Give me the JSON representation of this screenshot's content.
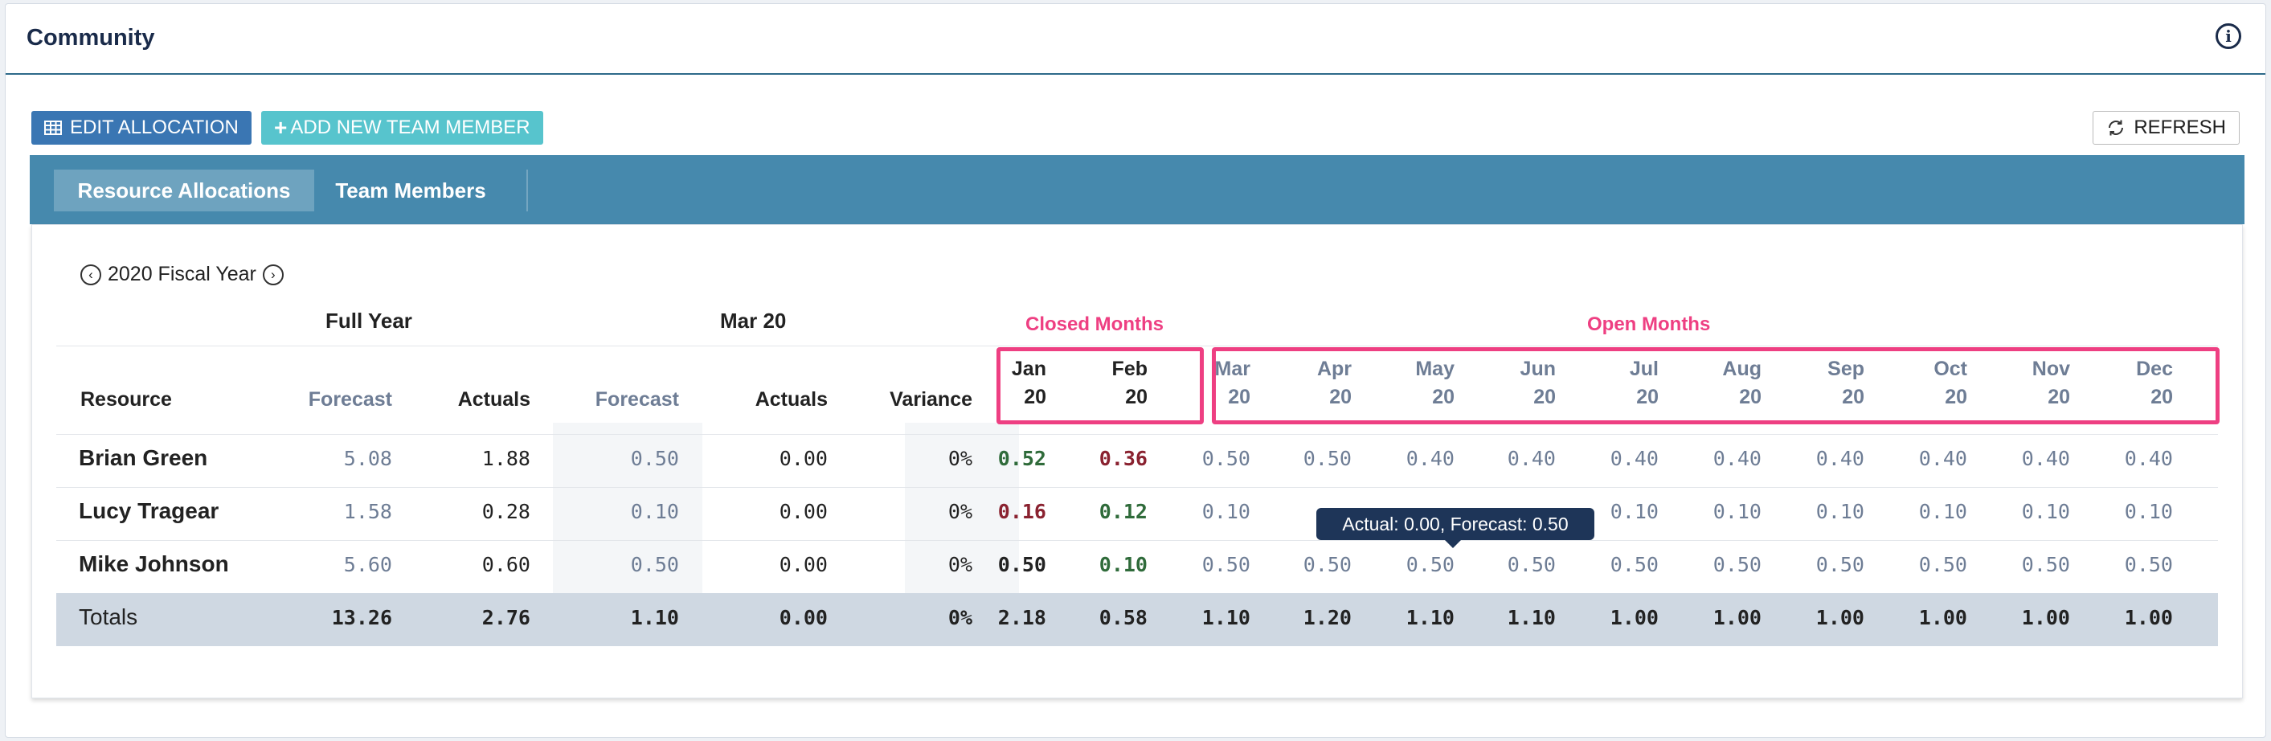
{
  "header": {
    "title": "Community",
    "info_icon": "info-icon"
  },
  "toolbar": {
    "edit_label": "EDIT ALLOCATION",
    "add_label": "ADD NEW TEAM MEMBER",
    "refresh_label": "REFRESH"
  },
  "tabs": [
    {
      "label": "Resource Allocations"
    },
    {
      "label": "Team Members"
    }
  ],
  "fiscal": {
    "label": "2020 Fiscal Year"
  },
  "groups": {
    "full_year": "Full Year",
    "current_month": "Mar 20",
    "closed": "Closed Months",
    "open": "Open Months"
  },
  "columns": {
    "resource": "Resource",
    "fy_forecast": "Forecast",
    "fy_actuals": "Actuals",
    "m_forecast": "Forecast",
    "m_actuals": "Actuals",
    "variance": "Variance"
  },
  "months": [
    {
      "m": "Jan",
      "y": "20"
    },
    {
      "m": "Feb",
      "y": "20"
    },
    {
      "m": "Mar",
      "y": "20"
    },
    {
      "m": "Apr",
      "y": "20"
    },
    {
      "m": "May",
      "y": "20"
    },
    {
      "m": "Jun",
      "y": "20"
    },
    {
      "m": "Jul",
      "y": "20"
    },
    {
      "m": "Aug",
      "y": "20"
    },
    {
      "m": "Sep",
      "y": "20"
    },
    {
      "m": "Oct",
      "y": "20"
    },
    {
      "m": "Nov",
      "y": "20"
    },
    {
      "m": "Dec",
      "y": "20"
    }
  ],
  "rows": [
    {
      "name": "Brian Green",
      "fy_forecast": "5.08",
      "fy_actuals": "1.88",
      "m_forecast": "0.50",
      "m_actuals": "0.00",
      "variance": "0%",
      "months": [
        "0.52",
        "0.36",
        "0.50",
        "0.50",
        "0.40",
        "0.40",
        "0.40",
        "0.40",
        "0.40",
        "0.40",
        "0.40",
        "0.40"
      ]
    },
    {
      "name": "Lucy Tragear",
      "fy_forecast": "1.58",
      "fy_actuals": "0.28",
      "m_forecast": "0.10",
      "m_actuals": "0.00",
      "variance": "0%",
      "months": [
        "0.16",
        "0.12",
        "0.10",
        "",
        "",
        "",
        "0.10",
        "0.10",
        "0.10",
        "0.10",
        "0.10",
        "0.10"
      ]
    },
    {
      "name": "Mike Johnson",
      "fy_forecast": "5.60",
      "fy_actuals": "0.60",
      "m_forecast": "0.50",
      "m_actuals": "0.00",
      "variance": "0%",
      "months": [
        "0.50",
        "0.10",
        "0.50",
        "0.50",
        "0.50",
        "0.50",
        "0.50",
        "0.50",
        "0.50",
        "0.50",
        "0.50",
        "0.50"
      ]
    }
  ],
  "totals": {
    "name": "Totals",
    "fy_forecast": "13.26",
    "fy_actuals": "2.76",
    "m_forecast": "1.10",
    "m_actuals": "0.00",
    "variance": "0%",
    "months": [
      "2.18",
      "0.58",
      "1.10",
      "1.20",
      "1.10",
      "1.10",
      "1.00",
      "1.00",
      "1.00",
      "1.00",
      "1.00",
      "1.00"
    ]
  },
  "colors": {
    "over": "#2f6b3a",
    "under": "#8a2230",
    "neutral": "#222222",
    "forecast": "#6e7d95",
    "highlight": "#ee3f82"
  },
  "closed_status": [
    [
      "over",
      "under"
    ],
    [
      "under",
      "over"
    ],
    [
      "neutral",
      "over"
    ]
  ],
  "tooltip": {
    "text": "Actual: 0.00, Forecast: 0.50"
  }
}
